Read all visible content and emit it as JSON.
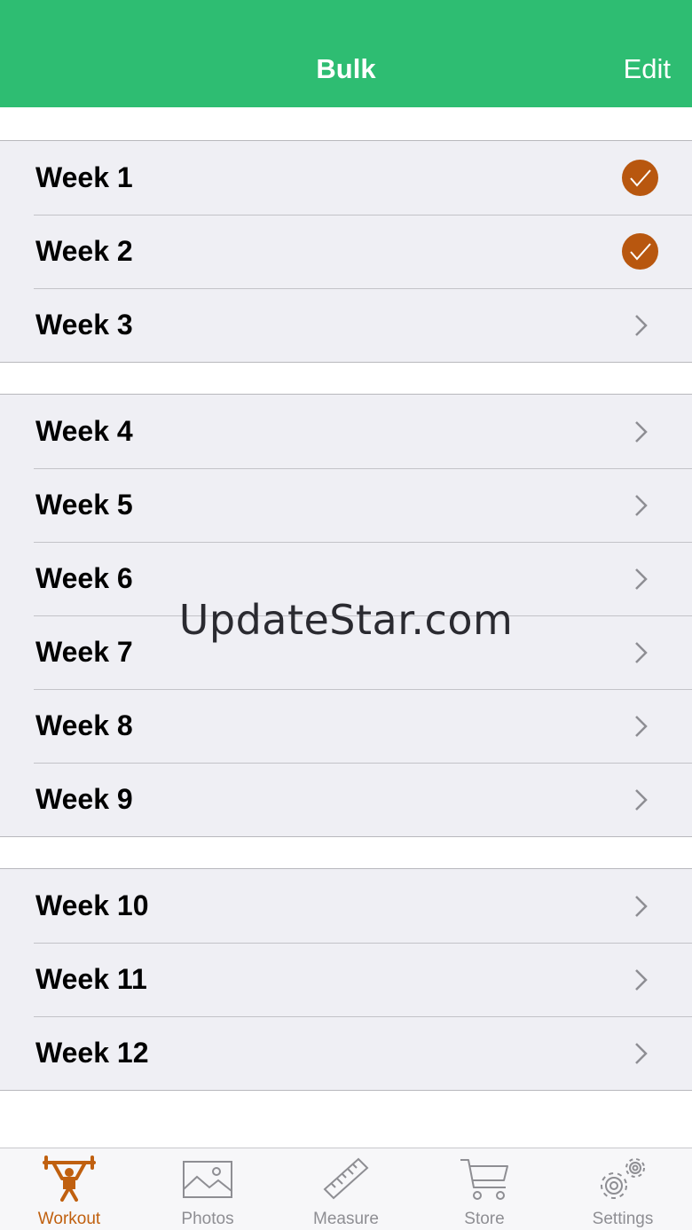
{
  "nav": {
    "title": "Bulk",
    "edit_label": "Edit"
  },
  "sections": [
    {
      "rows": [
        {
          "label": "Week 1",
          "status": "completed",
          "icon": "checkmark-icon"
        },
        {
          "label": "Week 2",
          "status": "completed",
          "icon": "checkmark-icon"
        },
        {
          "label": "Week 3",
          "status": "pending",
          "icon": "chevron-right-icon"
        }
      ]
    },
    {
      "rows": [
        {
          "label": "Week 4",
          "status": "pending",
          "icon": "chevron-right-icon"
        },
        {
          "label": "Week 5",
          "status": "pending",
          "icon": "chevron-right-icon"
        },
        {
          "label": "Week 6",
          "status": "pending",
          "icon": "chevron-right-icon"
        },
        {
          "label": "Week 7",
          "status": "pending",
          "icon": "chevron-right-icon"
        },
        {
          "label": "Week 8",
          "status": "pending",
          "icon": "chevron-right-icon"
        },
        {
          "label": "Week 9",
          "status": "pending",
          "icon": "chevron-right-icon"
        }
      ]
    },
    {
      "rows": [
        {
          "label": "Week 10",
          "status": "pending",
          "icon": "chevron-right-icon"
        },
        {
          "label": "Week 11",
          "status": "pending",
          "icon": "chevron-right-icon"
        },
        {
          "label": "Week 12",
          "status": "pending",
          "icon": "chevron-right-icon"
        }
      ]
    }
  ],
  "watermark": "UpdateStar.com",
  "tabs": [
    {
      "label": "Workout",
      "icon": "weightlifter-icon",
      "active": true
    },
    {
      "label": "Photos",
      "icon": "photo-icon",
      "active": false
    },
    {
      "label": "Measure",
      "icon": "ruler-icon",
      "active": false
    },
    {
      "label": "Store",
      "icon": "cart-icon",
      "active": false
    },
    {
      "label": "Settings",
      "icon": "gears-icon",
      "active": false
    }
  ],
  "colors": {
    "accent": "#2ebd72",
    "check": "#b8570f",
    "active_tab": "#c0600f",
    "inactive_tab": "#8e8e93"
  }
}
